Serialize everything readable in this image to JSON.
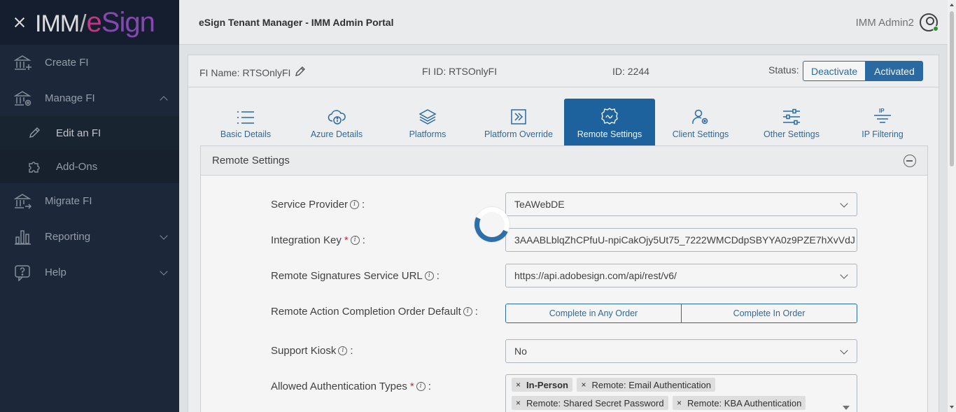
{
  "brand": {
    "imm": "IMM",
    "e": "e",
    "sign": "Sign"
  },
  "sidebar": {
    "items": [
      {
        "label": "Create FI",
        "icon": "bank-plus-icon"
      },
      {
        "label": "Manage FI",
        "icon": "bank-gear-icon",
        "expanded": true
      },
      {
        "label": "Migrate FI",
        "icon": "bank-arrow-icon"
      },
      {
        "label": "Reporting",
        "icon": "bar-chart-icon"
      },
      {
        "label": "Help",
        "icon": "question-bubble-icon"
      }
    ],
    "subitems": [
      {
        "label": "Edit an FI",
        "icon": "pencil-icon"
      },
      {
        "label": "Add-Ons",
        "icon": "puzzle-icon"
      }
    ]
  },
  "header": {
    "title": "eSign Tenant Manager - IMM Admin Portal",
    "user": "IMM Admin2"
  },
  "fi": {
    "name": "FI Name: RTSOnlyFI",
    "fi_id": "FI ID: RTSOnlyFI",
    "id": "ID: 2244",
    "status_label": "Status:",
    "deactivate": "Deactivate",
    "activated": "Activated"
  },
  "tabs": [
    {
      "label": "Basic Details",
      "icon": "list-icon"
    },
    {
      "label": "Azure Details",
      "icon": "cloud-info-icon"
    },
    {
      "label": "Platforms",
      "icon": "layers-icon"
    },
    {
      "label": "Platform Override",
      "icon": "arrow-box-icon"
    },
    {
      "label": "Remote Settings",
      "icon": "gear-badge-icon",
      "active": true
    },
    {
      "label": "Client Settings",
      "icon": "user-gear-icon"
    },
    {
      "label": "Other Settings",
      "icon": "sliders-icon"
    },
    {
      "label": "IP Filtering",
      "icon": "ip-filter-icon"
    }
  ],
  "panel": {
    "title": "Remote Settings",
    "fields": {
      "service_provider": {
        "label": "Service Provider",
        "value": "TeAWebDE"
      },
      "integration_key": {
        "label": "Integration Key",
        "value": "3AAABLblqZhCPfuU-npiCakOjy5Ut75_7222WMCDdpSBYYA0z9PZE7hXvVdJ"
      },
      "service_url": {
        "label": "Remote Signatures Service URL",
        "value": "https://api.adobesign.com/api/rest/v6/"
      },
      "completion_order": {
        "label": "Remote Action Completion Order Default",
        "options": [
          "Complete in Any Order",
          "Complete In Order"
        ]
      },
      "support_kiosk": {
        "label": "Support Kiosk",
        "value": "No"
      },
      "auth_types": {
        "label": "Allowed Authentication Types",
        "chips": [
          "In-Person",
          "Remote: Email Authentication",
          "Remote: Shared Secret Password",
          "Remote: KBA Authentication"
        ]
      }
    }
  },
  "colors": {
    "accent": "#2d6fa8",
    "sidebar": "#1e2a3c",
    "required": "#d03030"
  }
}
